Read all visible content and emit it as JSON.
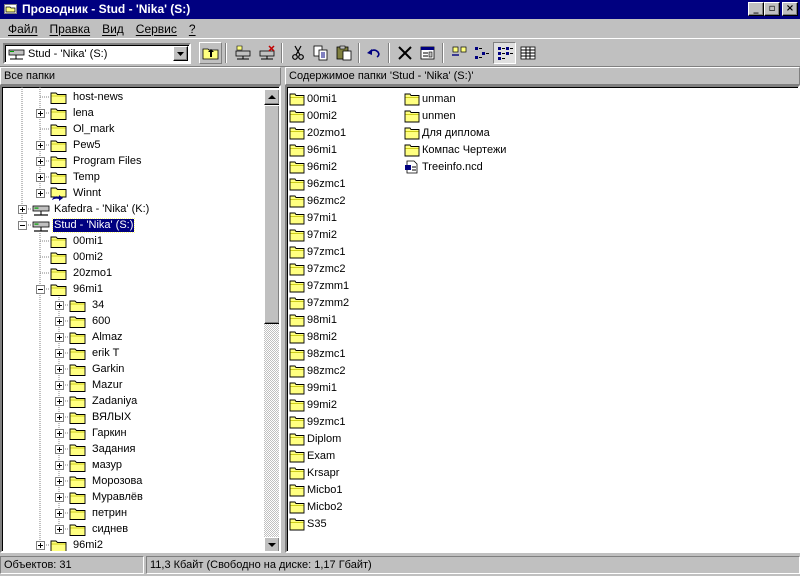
{
  "window": {
    "title": "Проводник - Stud - 'Nika' (S:)",
    "minimize": "_",
    "maximize": "▫",
    "close": "×"
  },
  "menu": [
    "Файл",
    "Правка",
    "Вид",
    "Сервис",
    "?"
  ],
  "address": {
    "value": "Stud - 'Nika' (S:)"
  },
  "panes": {
    "tree_header": "Все папки",
    "list_header": "Содержимое папки 'Stud - 'Nika' (S:)'"
  },
  "tree": [
    {
      "label": "host-news",
      "level": 2,
      "expander": "none"
    },
    {
      "label": "lena",
      "level": 2,
      "expander": "plus"
    },
    {
      "label": "Ol_mark",
      "level": 2,
      "expander": "none"
    },
    {
      "label": "Pew5",
      "level": 2,
      "expander": "plus"
    },
    {
      "label": "Program Files",
      "level": 2,
      "expander": "plus"
    },
    {
      "label": "Temp",
      "level": 2,
      "expander": "plus"
    },
    {
      "label": "Winnt",
      "level": 2,
      "expander": "plus",
      "icon": "shared-folder-icon"
    },
    {
      "label": "Kafedra - 'Nika' (K:)",
      "level": 1,
      "expander": "plus",
      "icon": "network-drive-icon"
    },
    {
      "label": "Stud - 'Nika' (S:)",
      "level": 1,
      "expander": "minus",
      "icon": "network-drive-icon",
      "selected": true
    },
    {
      "label": "00mi1",
      "level": 2,
      "expander": "none"
    },
    {
      "label": "00mi2",
      "level": 2,
      "expander": "none"
    },
    {
      "label": "20zmo1",
      "level": 2,
      "expander": "none"
    },
    {
      "label": "96mi1",
      "level": 2,
      "expander": "minus"
    },
    {
      "label": "34",
      "level": 3,
      "expander": "plus"
    },
    {
      "label": "600",
      "level": 3,
      "expander": "plus"
    },
    {
      "label": "Almaz",
      "level": 3,
      "expander": "plus"
    },
    {
      "label": "erik T",
      "level": 3,
      "expander": "plus"
    },
    {
      "label": "Garkin",
      "level": 3,
      "expander": "plus"
    },
    {
      "label": "Mazur",
      "level": 3,
      "expander": "plus"
    },
    {
      "label": "Zadaniya",
      "level": 3,
      "expander": "plus"
    },
    {
      "label": "ВЯЛЫХ",
      "level": 3,
      "expander": "plus"
    },
    {
      "label": "Гаркин",
      "level": 3,
      "expander": "plus"
    },
    {
      "label": "Задания",
      "level": 3,
      "expander": "plus"
    },
    {
      "label": "мазур",
      "level": 3,
      "expander": "plus"
    },
    {
      "label": "Морозова",
      "level": 3,
      "expander": "plus"
    },
    {
      "label": "Муравлёв",
      "level": 3,
      "expander": "plus"
    },
    {
      "label": "петрин",
      "level": 3,
      "expander": "plus"
    },
    {
      "label": "сиднев",
      "level": 3,
      "expander": "plus"
    },
    {
      "label": "96mi2",
      "level": 2,
      "expander": "plus"
    }
  ],
  "list_columns": [
    [
      {
        "label": "00mi1",
        "icon": "folder-icon"
      },
      {
        "label": "00mi2",
        "icon": "folder-icon"
      },
      {
        "label": "20zmo1",
        "icon": "folder-icon"
      },
      {
        "label": "96mi1",
        "icon": "folder-icon"
      },
      {
        "label": "96mi2",
        "icon": "folder-icon"
      },
      {
        "label": "96zmc1",
        "icon": "folder-icon"
      },
      {
        "label": "96zmc2",
        "icon": "folder-icon"
      },
      {
        "label": "97mi1",
        "icon": "folder-icon"
      },
      {
        "label": "97mi2",
        "icon": "folder-icon"
      },
      {
        "label": "97zmc1",
        "icon": "folder-icon"
      },
      {
        "label": "97zmc2",
        "icon": "folder-icon"
      },
      {
        "label": "97zmm1",
        "icon": "folder-icon"
      },
      {
        "label": "97zmm2",
        "icon": "folder-icon"
      },
      {
        "label": "98mi1",
        "icon": "folder-icon"
      },
      {
        "label": "98mi2",
        "icon": "folder-icon"
      },
      {
        "label": "98zmc1",
        "icon": "folder-icon"
      },
      {
        "label": "98zmc2",
        "icon": "folder-icon"
      },
      {
        "label": "99mi1",
        "icon": "folder-icon"
      },
      {
        "label": "99mi2",
        "icon": "folder-icon"
      },
      {
        "label": "99zmc1",
        "icon": "folder-icon"
      },
      {
        "label": "Diplom",
        "icon": "folder-icon"
      },
      {
        "label": "Exam",
        "icon": "folder-icon"
      },
      {
        "label": "Krsapr",
        "icon": "folder-icon"
      },
      {
        "label": "Micbo1",
        "icon": "folder-icon"
      },
      {
        "label": "Micbo2",
        "icon": "folder-icon"
      },
      {
        "label": "S35",
        "icon": "folder-icon"
      }
    ],
    [
      {
        "label": "unman",
        "icon": "folder-icon"
      },
      {
        "label": "unmen",
        "icon": "folder-icon"
      },
      {
        "label": "Для диплома",
        "icon": "folder-icon"
      },
      {
        "label": "Компас Чертежи",
        "icon": "folder-icon"
      },
      {
        "label": "Treeinfo.ncd",
        "icon": "file-icon"
      }
    ]
  ],
  "status": {
    "objects": "Объектов: 31",
    "size": "11,3 Кбайт (Свободно на диске: 1,17 Гбайт)"
  },
  "colors": {
    "face": "#c0c0c0",
    "title": "#000080",
    "folder": "#ffff80",
    "selection": "#000080"
  }
}
